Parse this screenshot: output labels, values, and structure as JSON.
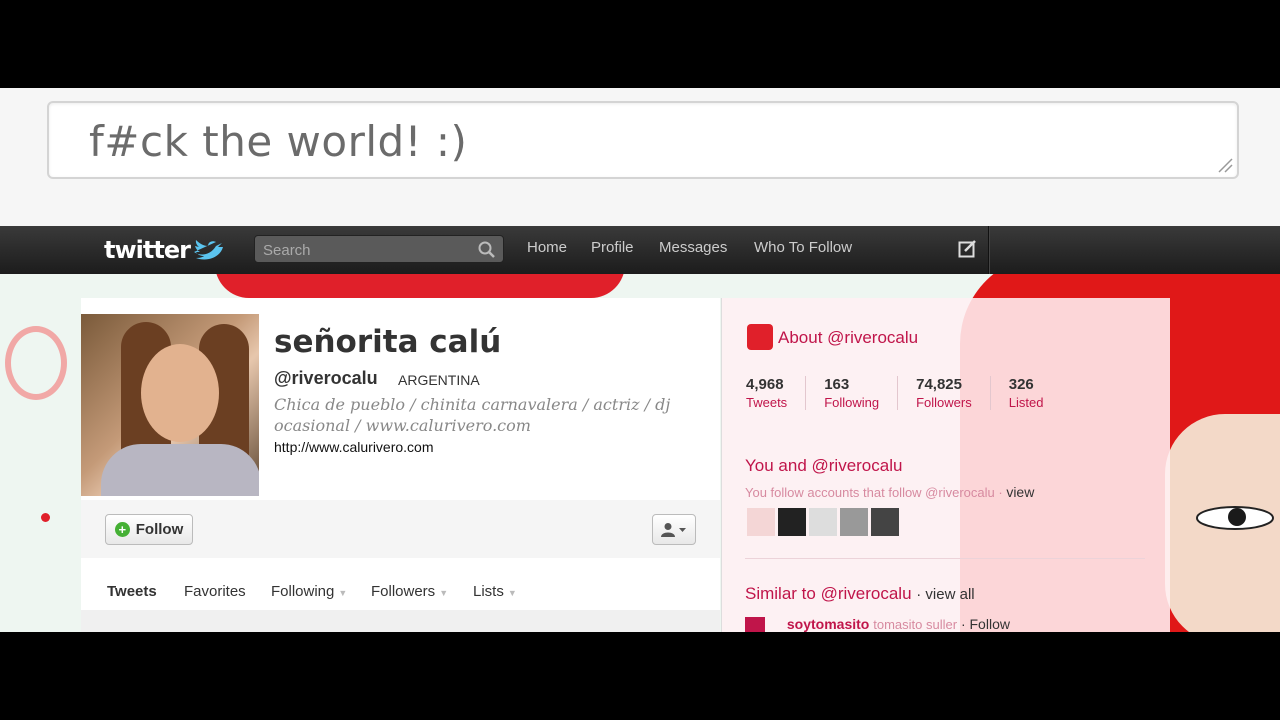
{
  "composer": {
    "text": "f#ck the world! :)"
  },
  "topbar": {
    "logo": "twitter",
    "search_placeholder": "Search",
    "nav": {
      "home": "Home",
      "profile": "Profile",
      "messages": "Messages",
      "who_to_follow": "Who To Follow"
    }
  },
  "profile": {
    "full_name": "señorita calú",
    "screen_name": "@riverocalu",
    "location": "ARGENTINA",
    "bio": "Chica de pueblo / chinita carnavalera / actriz / dj ocasional / www.calurivero.com",
    "url": "http://www.calurivero.com",
    "follow_label": "Follow"
  },
  "tabs": {
    "tweets": "Tweets",
    "favorites": "Favorites",
    "following": "Following",
    "followers": "Followers",
    "lists": "Lists"
  },
  "side": {
    "about_title": "About @riverocalu",
    "stats": [
      {
        "num": "4,968",
        "label": "Tweets"
      },
      {
        "num": "163",
        "label": "Following"
      },
      {
        "num": "74,825",
        "label": "Followers"
      },
      {
        "num": "326",
        "label": "Listed"
      }
    ],
    "you_and_title": "You and @riverocalu",
    "you_follow_text": "You follow accounts that follow @riverocalu ·",
    "view_label": "view",
    "similar_title": "Similar to @riverocalu",
    "view_all_label": "· view all",
    "similar_item": {
      "handle": "soytomasito",
      "name": "tomasito suller",
      "follow": "· Follow"
    }
  },
  "colors": {
    "brand_accent": "#c0154a",
    "topbar": "#2a2a2a",
    "profile_red": "#e0202a"
  }
}
